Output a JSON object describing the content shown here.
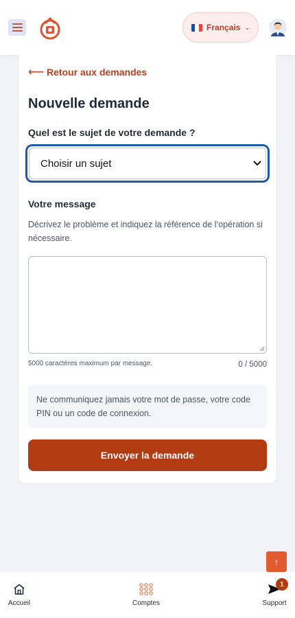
{
  "header": {
    "language": {
      "label": "Français",
      "flag_colors": [
        "#0055a4",
        "#ffffff",
        "#ef4135"
      ]
    },
    "icons": {
      "menu": "hamburger-menu-icon",
      "logo": "brand-logo-icon",
      "avatar": "user-avatar-icon"
    }
  },
  "form": {
    "back_link": {
      "arrow": "⟵",
      "label": "Retour aux demandes"
    },
    "title": "Nouvelle demande",
    "subject_label": "Quel est le sujet de votre demande ?",
    "subject_select": {
      "selected": "Choisir un sujet"
    },
    "message_label": "Votre message",
    "message_help": "Décrivez le problème et indiquez la référence de l’opération si nécessaire.",
    "message_value": "",
    "max_note": "5000 caractères maximum par message.",
    "counter": "0 / 5000",
    "warning": "Ne communiquez jamais votre mot de passe, votre code PIN ou un code de connexion.",
    "submit_label": "Envoyer la demande"
  },
  "scroll_top": {
    "icon": "arrow-up-icon",
    "glyph": "↑"
  },
  "bottom_nav": {
    "items": [
      {
        "label": "Accueil",
        "icon": "home-icon"
      },
      {
        "label": "Comptes",
        "icon": "accounts-grid-icon"
      },
      {
        "label": "Support",
        "icon": "send-icon",
        "badge": "1"
      }
    ]
  },
  "colors": {
    "accent": "#b23b12",
    "link": "#b5401f",
    "focus": "#1e5aa8",
    "scroll_button": "#e25a30"
  }
}
